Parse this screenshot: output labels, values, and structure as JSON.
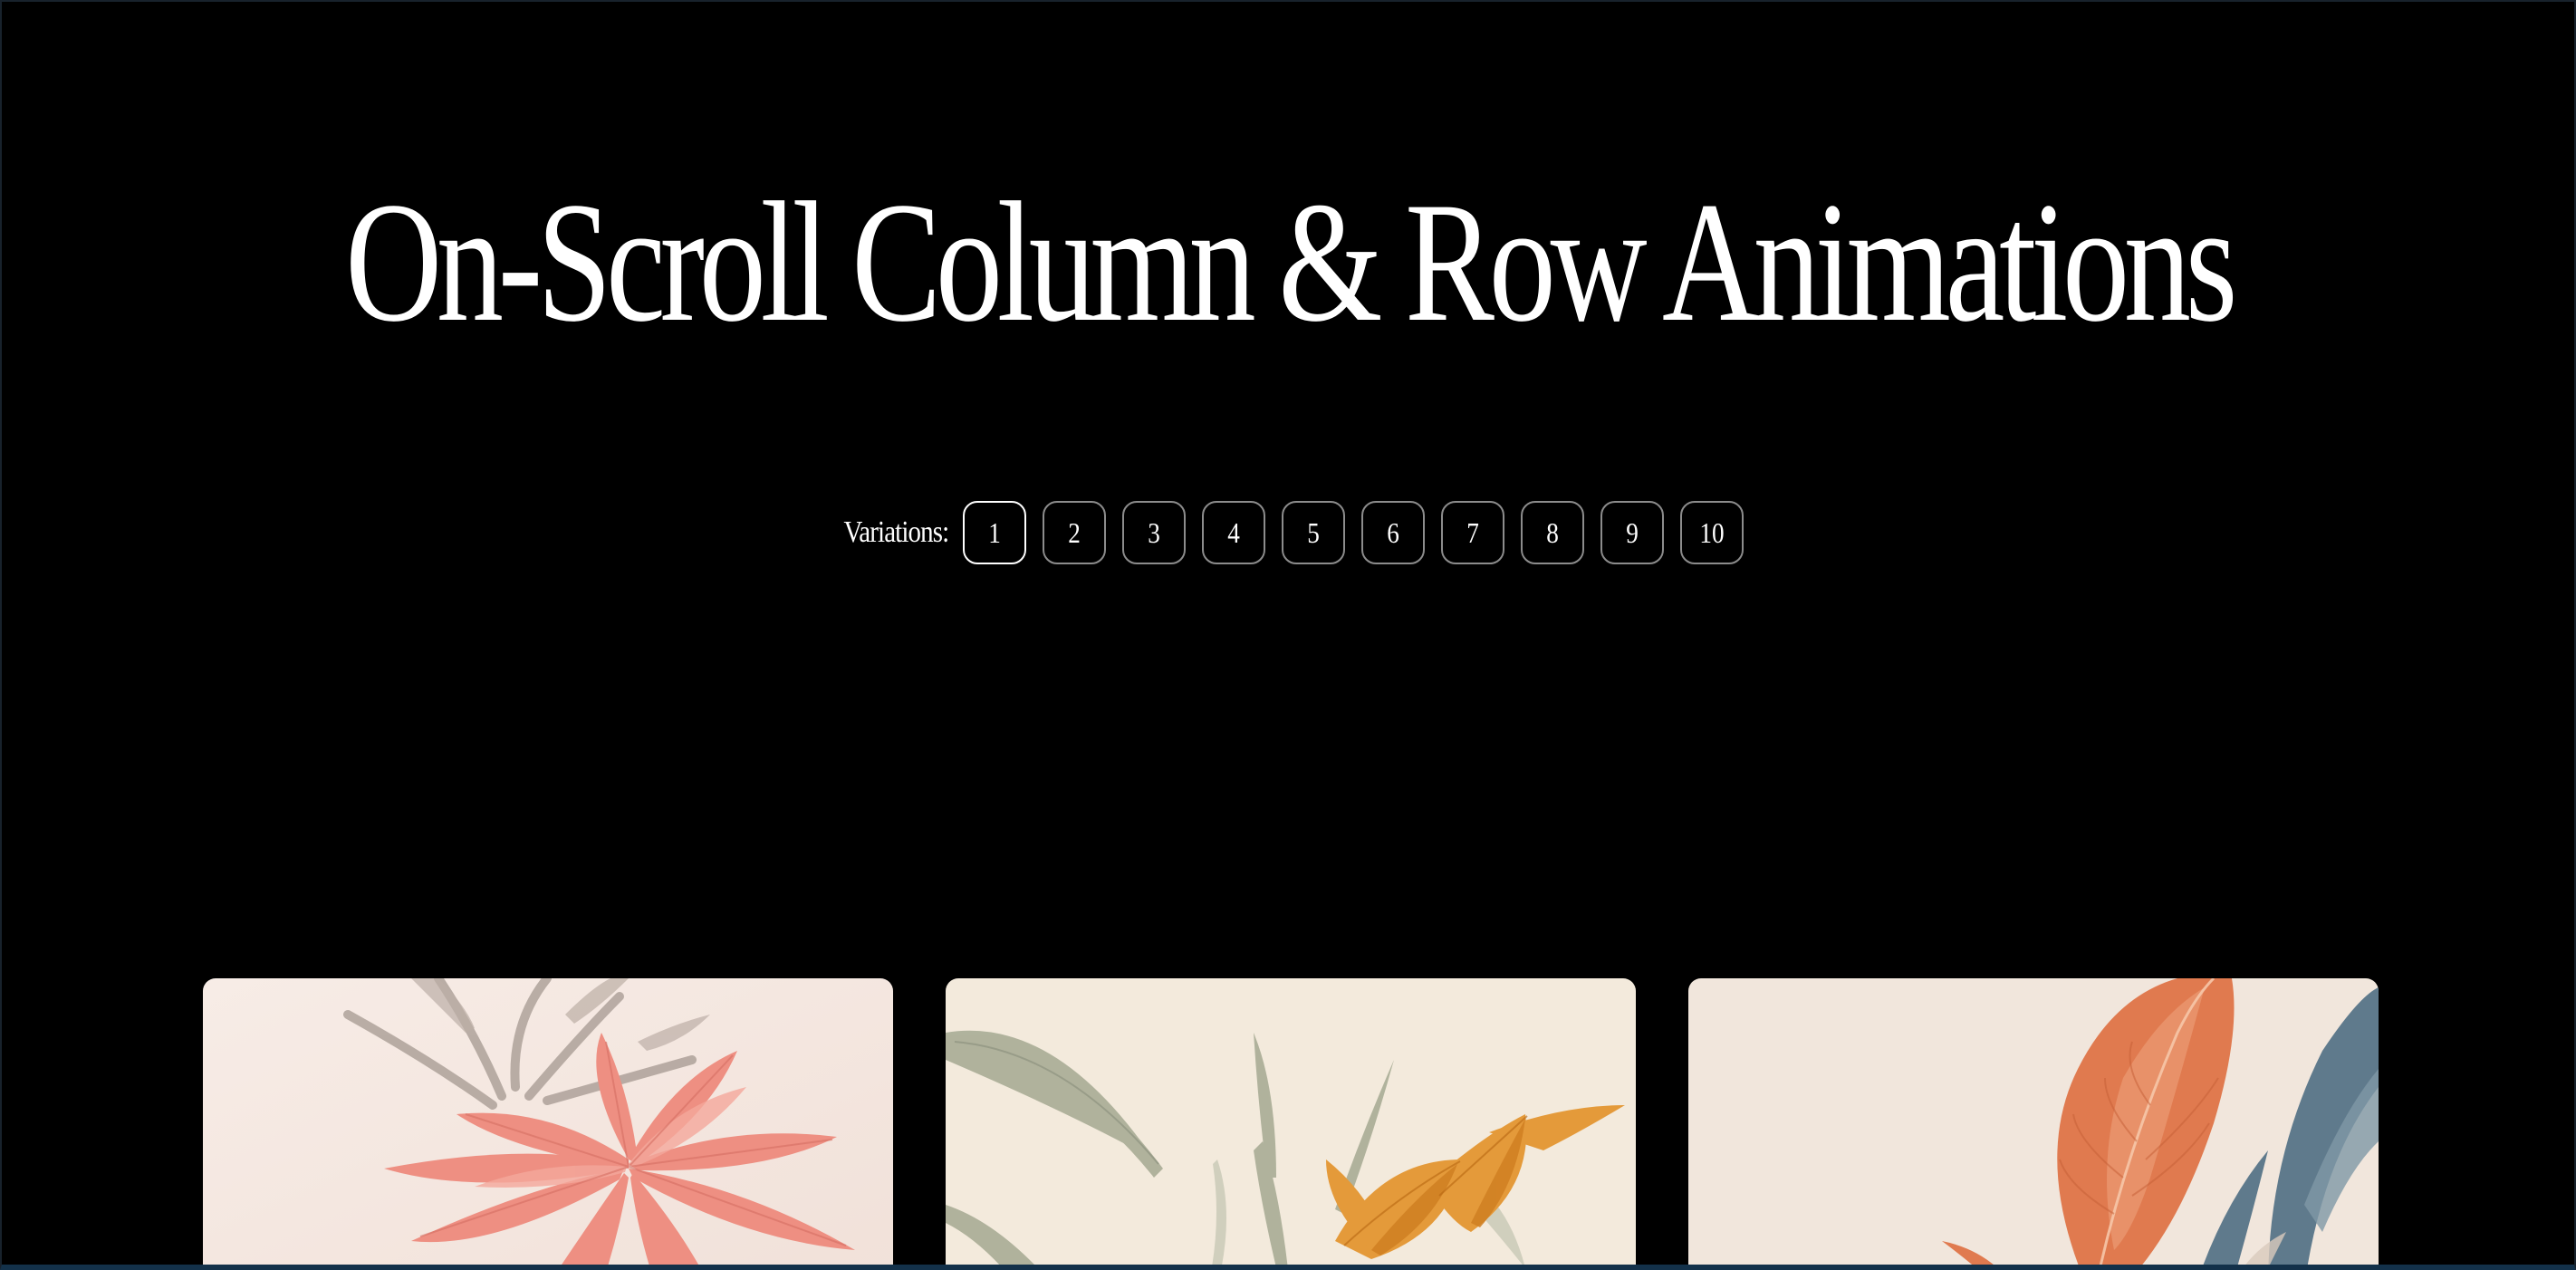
{
  "header": {
    "title": "On-Scroll Column & Row Animations"
  },
  "variations": {
    "label": "Variations:",
    "items": [
      "1",
      "2",
      "3",
      "4",
      "5",
      "6",
      "7",
      "8",
      "9",
      "10"
    ],
    "active_index": 0
  },
  "gallery": {
    "cards": [
      {
        "icon": "pink-palm-leaves-image"
      },
      {
        "icon": "sage-and-orange-leaves-image"
      },
      {
        "icon": "orange-and-blue-leaves-image"
      }
    ]
  },
  "colors": {
    "background": "#000000",
    "text": "#ffffff",
    "button_border": "#8c8c8c",
    "button_border_active": "#ffffff"
  }
}
